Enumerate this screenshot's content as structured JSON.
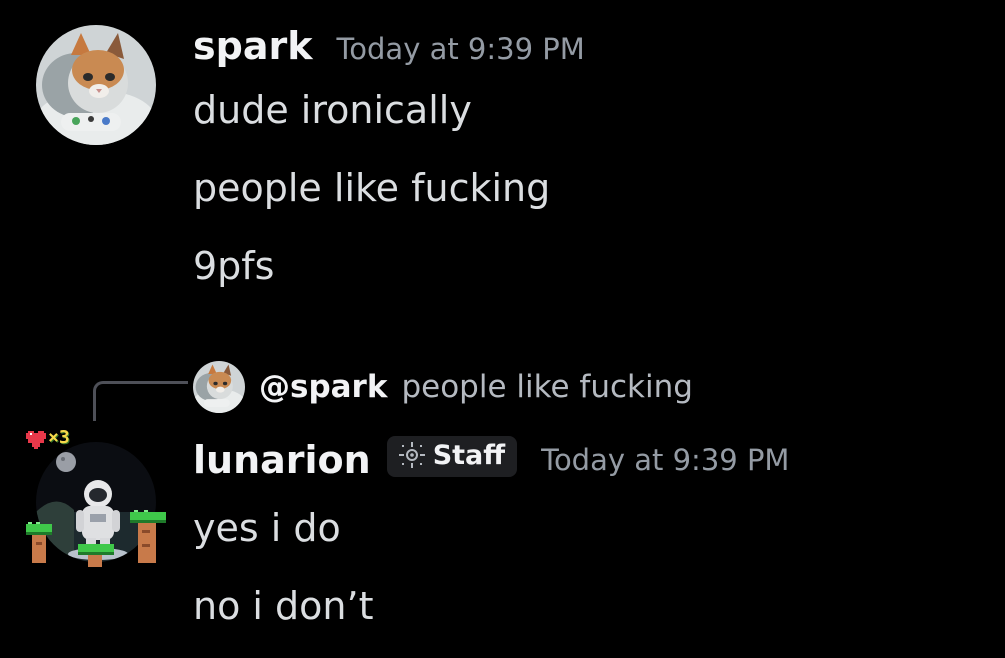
{
  "messages": [
    {
      "username": "spark",
      "timestamp": "Today at 9:39 PM",
      "lines": [
        "dude ironically",
        "people like fucking",
        "9pfs"
      ],
      "avatar_icon": "cat-avatar"
    },
    {
      "reply": {
        "mention": "@spark",
        "text": "people like fucking",
        "avatar_icon": "cat-avatar-small"
      },
      "username": "lunarion",
      "tag": {
        "label": "Staff",
        "icon": "crosshair-icon"
      },
      "timestamp": "Today at 9:39 PM",
      "lines": [
        "yes i do",
        "no i don’t"
      ],
      "avatar_icon": "astronaut-avatar",
      "decoration": {
        "lives_icon": "heart-icon",
        "lives": "×3"
      }
    }
  ],
  "colors": {
    "background": "#000000",
    "username": "#f2f3f5",
    "message_text": "#dbdee1",
    "timestamp": "#949ba4",
    "tag_background": "#1e1f22",
    "pixel_green": "#3fc84a",
    "pixel_brick": "#c87a4a",
    "heart": "#e8384a"
  }
}
